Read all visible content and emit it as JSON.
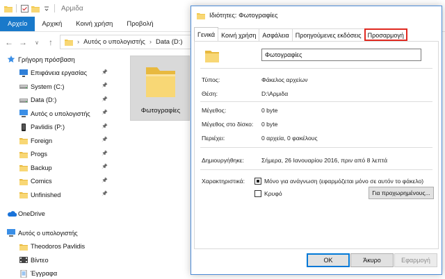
{
  "explorer": {
    "title": "Αρμιδα",
    "ribbon_tabs": [
      "Αρχείο",
      "Αρχική",
      "Κοινή χρήση",
      "Προβολή"
    ],
    "address": [
      "Αυτός ο υπολογιστής",
      "Data (D:)"
    ],
    "sidebar": [
      {
        "label": "Γρήγορη πρόσβαση",
        "icon": "star-icon",
        "top": true
      },
      {
        "label": "Επιφάνεια εργασίας",
        "icon": "desktop-icon",
        "pin": true
      },
      {
        "label": "System (C:)",
        "icon": "drive-icon",
        "pin": true
      },
      {
        "label": "Data (D:)",
        "icon": "drive-icon",
        "pin": true
      },
      {
        "label": "Αυτός ο υπολογιστής",
        "icon": "computer-icon",
        "pin": true
      },
      {
        "label": "Pavlidis (P:)",
        "icon": "phone-drive-icon",
        "pin": true
      },
      {
        "label": "Foreign",
        "icon": "folder-icon",
        "pin": true
      },
      {
        "label": "Progs",
        "icon": "folder-icon",
        "pin": true
      },
      {
        "label": "Backup",
        "icon": "folder-icon",
        "pin": true
      },
      {
        "label": "Comics",
        "icon": "folder-icon",
        "pin": true
      },
      {
        "label": "Unfinished",
        "icon": "folder-icon",
        "pin": true
      },
      {
        "gap": true
      },
      {
        "label": "OneDrive",
        "icon": "onedrive-icon",
        "top": true
      },
      {
        "gap": true
      },
      {
        "label": "Αυτός ο υπολογιστής",
        "icon": "computer-icon",
        "top": true
      },
      {
        "label": "Theodoros Pavlidis",
        "icon": "folder-icon"
      },
      {
        "label": "Βίντεο",
        "icon": "video-icon"
      },
      {
        "label": "Έγγραφα",
        "icon": "documents-icon"
      }
    ],
    "tile_label": "Φωτογραφίες"
  },
  "dialog": {
    "title": "Ιδιότητες: Φωτογραφίες",
    "tabs": [
      "Γενικά",
      "Κοινή χρήση",
      "Ασφάλεια",
      "Προηγούμενες εκδόσεις",
      "Προσαρμογή"
    ],
    "name_value": "Φωτογραφίες",
    "props": {
      "type_label": "Τύπος:",
      "type_value": "Φάκελος αρχείων",
      "location_label": "Θέση:",
      "location_value": "D:\\Αρμιδα",
      "size_label": "Μέγεθος:",
      "size_value": "0 byte",
      "disk_label": "Μέγεθος στο δίσκο:",
      "disk_value": "0 byte",
      "contains_label": "Περιέχει:",
      "contains_value": "0 αρχεία, 0 φακέλους",
      "created_label": "Δημιουργήθηκε:",
      "created_value": "Σήμερα, 26 Ιανουαρίου 2016, πριν από 8 λεπτά",
      "attributes_label": "Χαρακτηριστικά:",
      "readonly_label": "Μόνο για ανάγνωση (εφαρμόζεται μόνο σε αυτόν το φάκελο)",
      "hidden_label": "Κρυφό",
      "advanced_label": "Για προχωρημένους..."
    },
    "buttons": {
      "ok": "OK",
      "cancel": "Άκυρο",
      "apply": "Εφαρμογή"
    }
  },
  "colors": {
    "accent": "#1979ca",
    "folder": "#f8d775",
    "highlight": "#e0281f"
  }
}
